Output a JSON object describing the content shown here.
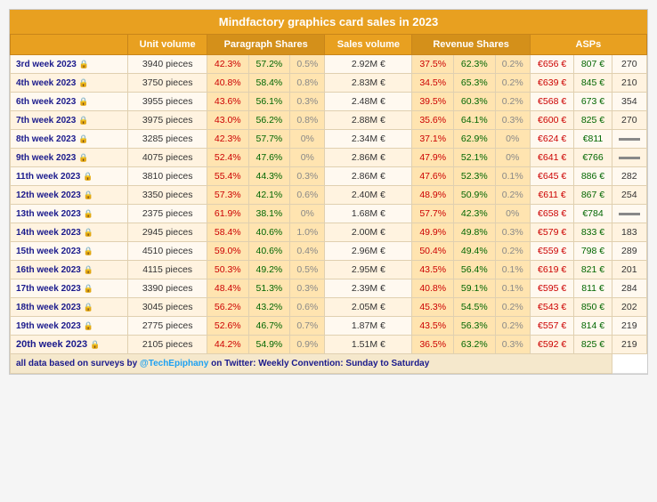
{
  "title": "Mindfactory graphics card sales in 2023",
  "columns": [
    "",
    "Unit volume",
    "Paragraph Shares",
    "Sales volume",
    "Revenue Shares",
    "ASPs"
  ],
  "rows": [
    {
      "week": "3rd week 2023",
      "unit": "3940 pieces",
      "para1": "42.3%",
      "para1_color": "red",
      "para2": "57.2%",
      "para2_color": "green",
      "para3": "0.5%",
      "para3_color": "gray",
      "sales": "2.92M €",
      "rev1": "37.5%",
      "rev1_color": "red",
      "rev2": "62.3%",
      "rev2_color": "green",
      "rev3": "0.2%",
      "rev3_color": "gray",
      "asp1": "€656 €",
      "asp2": "807 €",
      "asp3": "270"
    },
    {
      "week": "4th week 2023",
      "unit": "3750 pieces",
      "para1": "40.8%",
      "para1_color": "red",
      "para2": "58.4%",
      "para2_color": "green",
      "para3": "0.8%",
      "para3_color": "gray",
      "sales": "2.83M €",
      "rev1": "34.5%",
      "rev1_color": "red",
      "rev2": "65.3%",
      "rev2_color": "green",
      "rev3": "0.2%",
      "rev3_color": "gray",
      "asp1": "€639 €",
      "asp2": "845 €",
      "asp3": "210"
    },
    {
      "week": "6th week 2023",
      "unit": "3955 pieces",
      "para1": "43.6%",
      "para1_color": "red",
      "para2": "56.1%",
      "para2_color": "green",
      "para3": "0.3%",
      "para3_color": "gray",
      "sales": "2.48M €",
      "rev1": "39.5%",
      "rev1_color": "red",
      "rev2": "60.3%",
      "rev2_color": "green",
      "rev3": "0.2%",
      "rev3_color": "gray",
      "asp1": "€568 €",
      "asp2": "673 €",
      "asp3": "354"
    },
    {
      "week": "7th week 2023",
      "unit": "3975 pieces",
      "para1": "43.0%",
      "para1_color": "red",
      "para2": "56.2%",
      "para2_color": "green",
      "para3": "0.8%",
      "para3_color": "gray",
      "sales": "2.88M €",
      "rev1": "35.6%",
      "rev1_color": "red",
      "rev2": "64.1%",
      "rev2_color": "green",
      "rev3": "0.3%",
      "rev3_color": "gray",
      "asp1": "€600 €",
      "asp2": "825 €",
      "asp3": "270"
    },
    {
      "week": "8th week 2023",
      "unit": "3285 pieces",
      "para1": "42.3%",
      "para1_color": "red",
      "para2": "57.7%",
      "para2_color": "green",
      "para3": "0%",
      "para3_color": "gray",
      "sales": "2.34M €",
      "rev1": "37.1%",
      "rev1_color": "red",
      "rev2": "62.9%",
      "rev2_color": "green",
      "rev3": "0%",
      "rev3_color": "gray",
      "asp1": "€624 €",
      "asp2": "€811",
      "asp3": "dash"
    },
    {
      "week": "9th week 2023",
      "unit": "4075 pieces",
      "para1": "52.4%",
      "para1_color": "red",
      "para2": "47.6%",
      "para2_color": "green",
      "para3": "0%",
      "para3_color": "gray",
      "sales": "2.86M €",
      "rev1": "47.9%",
      "rev1_color": "red",
      "rev2": "52.1%",
      "rev2_color": "green",
      "rev3": "0%",
      "rev3_color": "gray",
      "asp1": "€641 €",
      "asp2": "€766",
      "asp3": "dash"
    },
    {
      "week": "11th week 2023",
      "unit": "3810 pieces",
      "para1": "55.4%",
      "para1_color": "red",
      "para2": "44.3%",
      "para2_color": "green",
      "para3": "0.3%",
      "para3_color": "gray",
      "sales": "2.86M €",
      "rev1": "47.6%",
      "rev1_color": "red",
      "rev2": "52.3%",
      "rev2_color": "green",
      "rev3": "0.1%",
      "rev3_color": "gray",
      "asp1": "€645 €",
      "asp2": "886 €",
      "asp3": "282"
    },
    {
      "week": "12th week 2023",
      "unit": "3350 pieces",
      "para1": "57.3%",
      "para1_color": "red",
      "para2": "42.1%",
      "para2_color": "green",
      "para3": "0.6%",
      "para3_color": "gray",
      "sales": "2.40M €",
      "rev1": "48.9%",
      "rev1_color": "red",
      "rev2": "50.9%",
      "rev2_color": "green",
      "rev3": "0.2%",
      "rev3_color": "gray",
      "asp1": "€611 €",
      "asp2": "867 €",
      "asp3": "254"
    },
    {
      "week": "13th week 2023",
      "unit": "2375 pieces",
      "para1": "61.9%",
      "para1_color": "red",
      "para2": "38.1%",
      "para2_color": "green",
      "para3": "0%",
      "para3_color": "gray",
      "sales": "1.68M €",
      "rev1": "57.7%",
      "rev1_color": "red",
      "rev2": "42.3%",
      "rev2_color": "green",
      "rev3": "0%",
      "rev3_color": "gray",
      "asp1": "€658 €",
      "asp2": "€784",
      "asp3": "dash"
    },
    {
      "week": "14th week 2023",
      "unit": "2945 pieces",
      "para1": "58.4%",
      "para1_color": "red",
      "para2": "40.6%",
      "para2_color": "green",
      "para3": "1.0%",
      "para3_color": "gray",
      "sales": "2.00M €",
      "rev1": "49.9%",
      "rev1_color": "red",
      "rev2": "49.8%",
      "rev2_color": "green",
      "rev3": "0.3%",
      "rev3_color": "gray",
      "asp1": "€579 €",
      "asp2": "833 €",
      "asp3": "183"
    },
    {
      "week": "15th week 2023",
      "unit": "4510 pieces",
      "para1": "59.0%",
      "para1_color": "red",
      "para2": "40.6%",
      "para2_color": "green",
      "para3": "0.4%",
      "para3_color": "gray",
      "sales": "2.96M €",
      "rev1": "50.4%",
      "rev1_color": "red",
      "rev2": "49.4%",
      "rev2_color": "green",
      "rev3": "0.2%",
      "rev3_color": "gray",
      "asp1": "€559 €",
      "asp2": "798 €",
      "asp3": "289"
    },
    {
      "week": "16th week 2023",
      "unit": "4115 pieces",
      "para1": "50.3%",
      "para1_color": "red",
      "para2": "49.2%",
      "para2_color": "green",
      "para3": "0.5%",
      "para3_color": "gray",
      "sales": "2.95M €",
      "rev1": "43.5%",
      "rev1_color": "red",
      "rev2": "56.4%",
      "rev2_color": "green",
      "rev3": "0.1%",
      "rev3_color": "gray",
      "asp1": "€619 €",
      "asp2": "821 €",
      "asp3": "201"
    },
    {
      "week": "17th week 2023",
      "unit": "3390 pieces",
      "para1": "48.4%",
      "para1_color": "red",
      "para2": "51.3%",
      "para2_color": "green",
      "para3": "0.3%",
      "para3_color": "gray",
      "sales": "2.39M €",
      "rev1": "40.8%",
      "rev1_color": "red",
      "rev2": "59.1%",
      "rev2_color": "green",
      "rev3": "0.1%",
      "rev3_color": "gray",
      "asp1": "€595 €",
      "asp2": "811 €",
      "asp3": "284"
    },
    {
      "week": "18th week 2023",
      "unit": "3045 pieces",
      "para1": "56.2%",
      "para1_color": "red",
      "para2": "43.2%",
      "para2_color": "green",
      "para3": "0.6%",
      "para3_color": "gray",
      "sales": "2.05M €",
      "rev1": "45.3%",
      "rev1_color": "red",
      "rev2": "54.5%",
      "rev2_color": "green",
      "rev3": "0.2%",
      "rev3_color": "gray",
      "asp1": "€543 €",
      "asp2": "850 €",
      "asp3": "202"
    },
    {
      "week": "19th week 2023",
      "unit": "2775 pieces",
      "para1": "52.6%",
      "para1_color": "red",
      "para2": "46.7%",
      "para2_color": "green",
      "para3": "0.7%",
      "para3_color": "gray",
      "sales": "1.87M €",
      "rev1": "43.5%",
      "rev1_color": "red",
      "rev2": "56.3%",
      "rev2_color": "green",
      "rev3": "0.2%",
      "rev3_color": "gray",
      "asp1": "€557 €",
      "asp2": "814 €",
      "asp3": "219"
    },
    {
      "week": "20th week 2023",
      "unit": "2105 pieces",
      "para1": "44.2%",
      "para1_color": "red",
      "para2": "54.9%",
      "para2_color": "green",
      "para3": "0.9%",
      "para3_color": "gray",
      "sales": "1.51M €",
      "rev1": "36.5%",
      "rev1_color": "red",
      "rev2": "63.2%",
      "rev2_color": "green",
      "rev3": "0.3%",
      "rev3_color": "gray",
      "asp1": "€592 €",
      "asp2": "825 €",
      "asp3": "219"
    }
  ],
  "footer": "all data based on surveys by @TechEpiphany on Twitter: Weekly Convention: Sunday to Saturday"
}
